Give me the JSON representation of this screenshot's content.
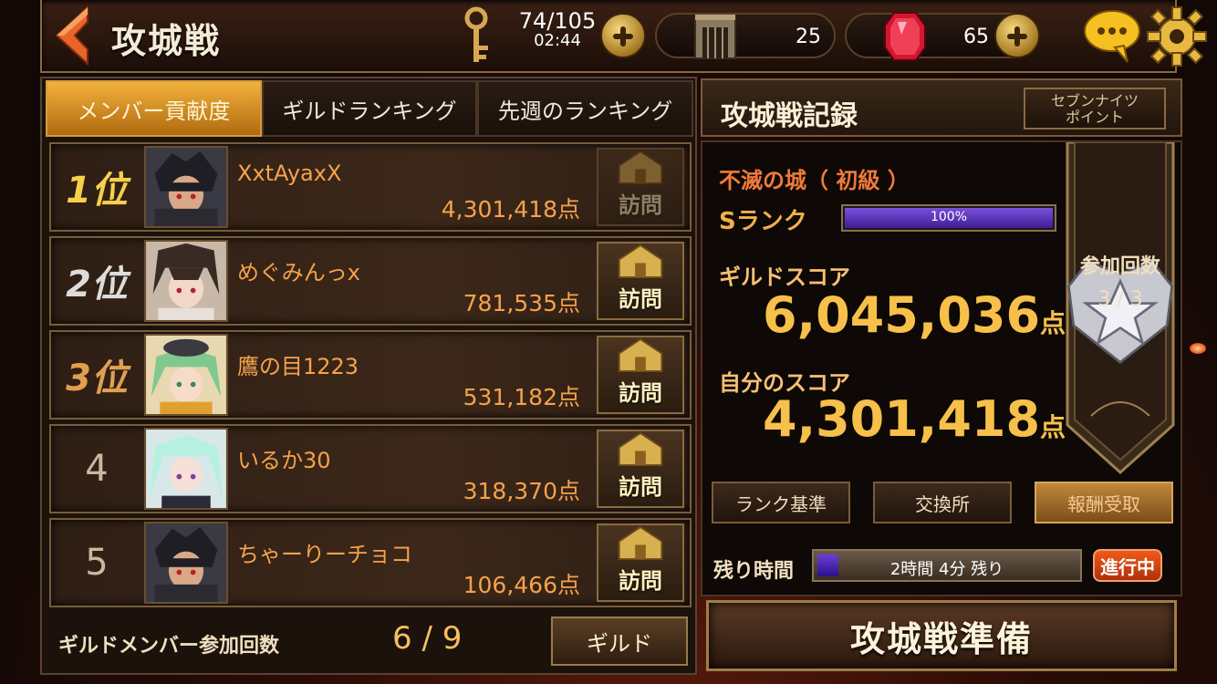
{
  "header": {
    "title": "攻城戦",
    "stamina_value": "74/105",
    "stamina_timer": "02:44",
    "gate_count": "25",
    "gem_count": "65"
  },
  "tabs": [
    {
      "label": "メンバー貢献度",
      "active": true
    },
    {
      "label": "ギルドランキング",
      "active": false
    },
    {
      "label": "先週のランキング",
      "active": false
    }
  ],
  "members": [
    {
      "rank": "1位",
      "name": "XxtAyaxX",
      "score": "4,301,418点",
      "visit_label": "訪問",
      "visit_enabled": false
    },
    {
      "rank": "2位",
      "name": "めぐみんっx",
      "score": "781,535点",
      "visit_label": "訪問",
      "visit_enabled": true
    },
    {
      "rank": "3位",
      "name": "鷹の目1223",
      "score": "531,182点",
      "visit_label": "訪問",
      "visit_enabled": true
    },
    {
      "rank": "4",
      "name": "いるか30",
      "score": "318,370点",
      "visit_label": "訪問",
      "visit_enabled": true
    },
    {
      "rank": "5",
      "name": "ちゃーりーチョコ",
      "score": "106,466点",
      "visit_label": "訪問",
      "visit_enabled": true
    }
  ],
  "footer": {
    "member_label": "ギルドメンバー参加回数",
    "member_count": "6 /  9",
    "guild_button": "ギルド"
  },
  "record": {
    "title": "攻城戦記録",
    "seven_knights_button_line1": "セブンナイツ",
    "seven_knights_button_line2": "ポイント",
    "castle": "不滅の城（ 初級 ）",
    "rank": "Sランク",
    "rank_progress_label": "100%",
    "rank_progress": 1.0,
    "guild_score_label": "ギルドスコア",
    "guild_score": "6,045,036",
    "my_score_label": "自分のスコア",
    "my_score": "4,301,418",
    "score_unit": "点",
    "participation_label": "参加回数",
    "participation_value": "3 / 3",
    "buttons": {
      "rank_criteria": "ランク基準",
      "exchange": "交換所",
      "reward": "報酬受取"
    },
    "remaining_label": "残り時間",
    "remaining_value": "2時間  4分  残り",
    "remaining_progress": 0.08,
    "status": "進行中",
    "prepare_button": "攻城戦準備"
  },
  "colors": {
    "accent_gold": "#f6c04a",
    "name_orange": "#f6a24a",
    "status_red": "#f05a1a",
    "progress_purple": "#5a30c0"
  }
}
